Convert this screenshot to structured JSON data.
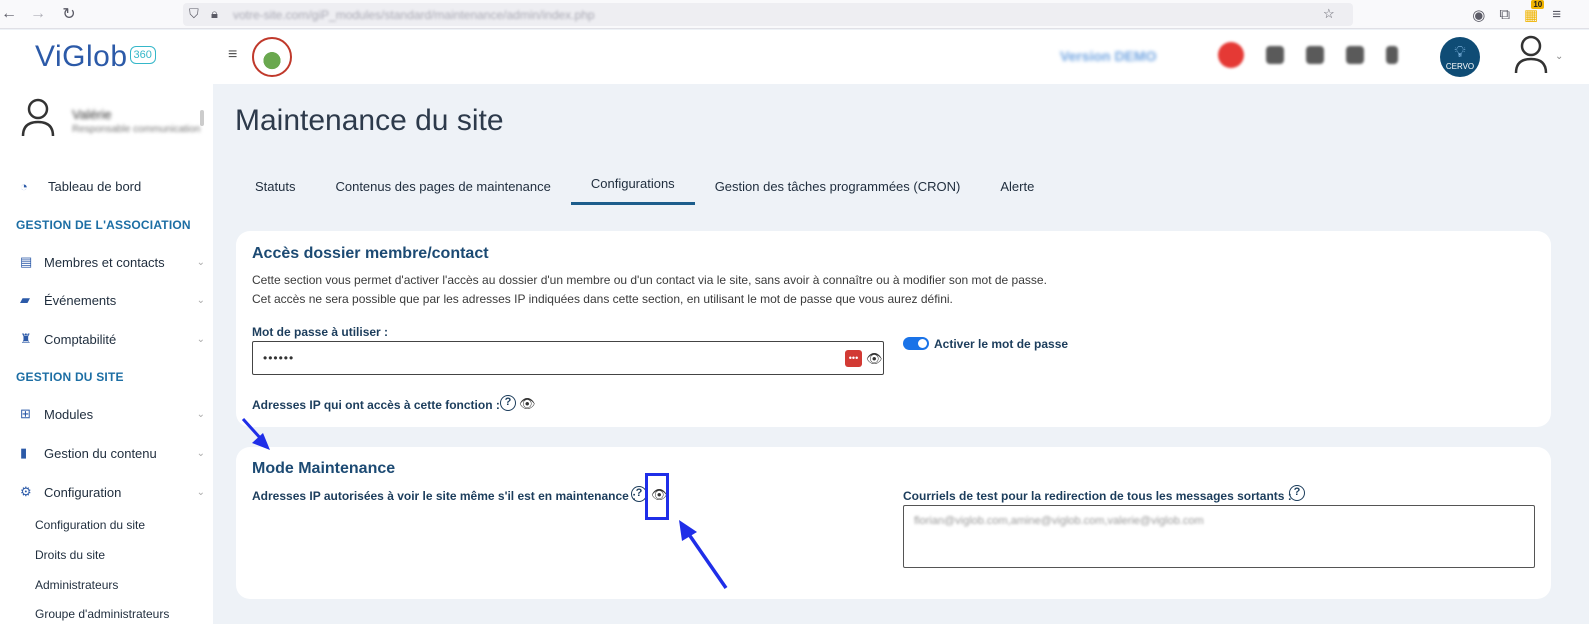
{
  "browser": {
    "url": "votre-site.com/giP_modules/standard/maintenance/admin/index.php",
    "extension_badge": "10"
  },
  "header": {
    "logo_text": "ViGlob",
    "logo_badge": "360",
    "blurred_link": "Version DEMO",
    "bulb_label": "CERVO"
  },
  "sidebar": {
    "profile_name": "Valérie",
    "profile_role": "Responsable communication",
    "dashboard": "Tableau de bord",
    "section_association": "GESTION DE L'ASSOCIATION",
    "members": "Membres et contacts",
    "events": "Événements",
    "accounting": "Comptabilité",
    "section_site": "GESTION DU SITE",
    "modules": "Modules",
    "content": "Gestion du contenu",
    "configuration": "Configuration",
    "sub_site_config": "Configuration du site",
    "sub_site_rights": "Droits du site",
    "sub_admins": "Administrateurs",
    "sub_admin_groups": "Groupe d'administrateurs"
  },
  "main": {
    "title": "Maintenance du site",
    "tabs": [
      {
        "label": "Statuts"
      },
      {
        "label": "Contenus des pages de maintenance"
      },
      {
        "label": "Configurations"
      },
      {
        "label": "Gestion des tâches programmées (CRON)"
      },
      {
        "label": "Alerte"
      }
    ],
    "active_tab": "Configurations"
  },
  "access_card": {
    "title": "Accès dossier membre/contact",
    "desc1": "Cette section vous permet d'activer l'accès au dossier d'un membre ou d'un contact via le site, sans avoir à connaître ou à modifier son mot de passe.",
    "desc2": "Cet accès ne sera possible que par les adresses IP indiquées dans cette section, en utilisant le mot de passe que vous aurez défini.",
    "password_label": "Mot de passe à utiliser :",
    "password_value": "••••••",
    "toggle_label": "Activer le mot de passe",
    "toggle_on": true,
    "ip_label": "Adresses IP qui ont accès à cette fonction :"
  },
  "maintenance_card": {
    "title": "Mode Maintenance",
    "ip_label": "Adresses IP autorisées à voir le site même s'il est en maintenance :",
    "emails_label": "Courriels de test pour la redirection de tous les messages sortants :",
    "emails_value": "florian@viglob.com,amine@viglob.com,valerie@viglob.com"
  },
  "colors": {
    "accent": "#1c5d8c",
    "section_heading": "#1c6ea4",
    "toggle": "#1a73e8",
    "annotation": "#1f2ee8"
  }
}
